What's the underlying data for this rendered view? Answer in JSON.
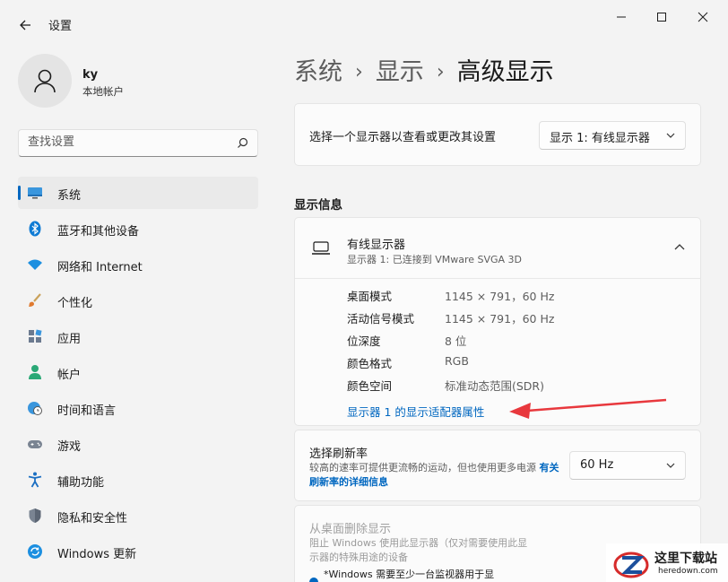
{
  "window": {
    "title": "设置"
  },
  "user": {
    "name": "ky",
    "account_type": "本地帐户"
  },
  "search": {
    "placeholder": "查找设置"
  },
  "sidebar": {
    "items": [
      {
        "label": "系统",
        "icon": "system-display-icon",
        "active": true
      },
      {
        "label": "蓝牙和其他设备",
        "icon": "bluetooth-icon"
      },
      {
        "label": "网络和 Internet",
        "icon": "wifi-icon"
      },
      {
        "label": "个性化",
        "icon": "brush-icon"
      },
      {
        "label": "应用",
        "icon": "apps-icon"
      },
      {
        "label": "帐户",
        "icon": "person-icon"
      },
      {
        "label": "时间和语言",
        "icon": "globe-clock-icon"
      },
      {
        "label": "游戏",
        "icon": "gamepad-icon"
      },
      {
        "label": "辅助功能",
        "icon": "accessibility-icon"
      },
      {
        "label": "隐私和安全性",
        "icon": "shield-icon"
      },
      {
        "label": "Windows 更新",
        "icon": "update-icon"
      }
    ]
  },
  "breadcrumb": {
    "items": [
      "系统",
      "显示",
      "高级显示"
    ],
    "separator": "›"
  },
  "display_select": {
    "label": "选择一个显示器以查看或更改其设置",
    "value": "显示 1: 有线显示器"
  },
  "display_info": {
    "section_title": "显示信息",
    "monitor_name": "有线显示器",
    "monitor_sub": "显示器 1: 已连接到 VMware SVGA 3D",
    "rows": [
      {
        "key": "桌面模式",
        "value": "1145 × 791，60 Hz"
      },
      {
        "key": "活动信号模式",
        "value": "1145 × 791，60 Hz"
      },
      {
        "key": "位深度",
        "value": "8 位"
      },
      {
        "key": "颜色格式",
        "value": "RGB"
      },
      {
        "key": "颜色空间",
        "value": "标准动态范围(SDR)"
      }
    ],
    "adapter_link": "显示器 1 的显示适配器属性"
  },
  "refresh": {
    "title": "选择刷新率",
    "desc": "较高的速率可提供更流畅的运动，但也使用更多电源",
    "link": "有关刷新率的详细信息",
    "value": "60 Hz"
  },
  "remove": {
    "title": "从桌面删除显示",
    "desc": "阻止 Windows 使用此显示器（仅对需要使用此显示器的特殊用途的设备",
    "note": "*Windows 需要至少一台监视器用于显"
  },
  "watermark": {
    "cn": "这里下载站",
    "en": "heredown.com"
  },
  "colors": {
    "accent": "#0067c0",
    "annotation": "#e8383d"
  }
}
